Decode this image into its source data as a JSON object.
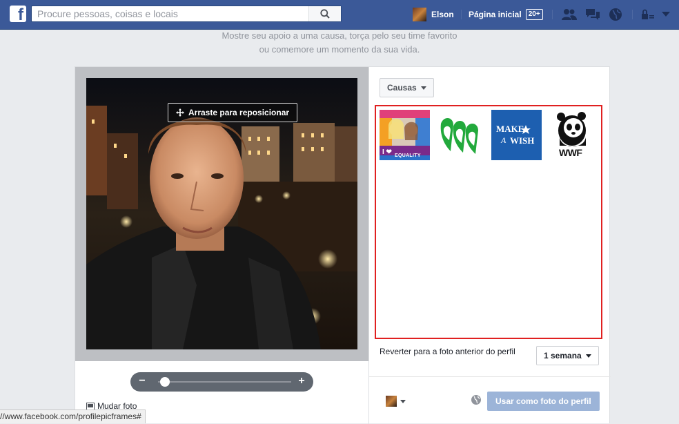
{
  "topbar": {
    "logo": "f",
    "search_placeholder": "Procure pessoas, coisas e locais",
    "user_name": "Elson",
    "home_label": "Página inicial",
    "home_badge": "20+"
  },
  "subtitle": {
    "line1": "Mostre seu apoio a uma causa, torça pelo seu time favorito",
    "line2": "ou comemore um momento da sua vida."
  },
  "editor": {
    "drag_label": "Arraste para reposicionar",
    "zoom_level": 0.05,
    "change_photo": "Mudar foto"
  },
  "frames": {
    "category": "Causas",
    "items": [
      {
        "name": "I ❤ Equality",
        "label": "EQUALITY"
      },
      {
        "name": "Girl Scouts",
        "label": ""
      },
      {
        "name": "Make-A-Wish",
        "label_1": "MAKE",
        "label_2": "A",
        "label_3": "WISH"
      },
      {
        "name": "WWF",
        "label": "WWF"
      }
    ]
  },
  "revert": {
    "label": "Reverter para a foto anterior do perfil",
    "duration": "1 semana"
  },
  "actions": {
    "use_as_profile": "Usar como foto do perfil"
  },
  "status_bar": {
    "url": "//www.facebook.com/profilepicframes#"
  },
  "colors": {
    "brand": "#3b5998",
    "highlight": "#e02020",
    "primary_disabled": "#9cb4d8"
  }
}
